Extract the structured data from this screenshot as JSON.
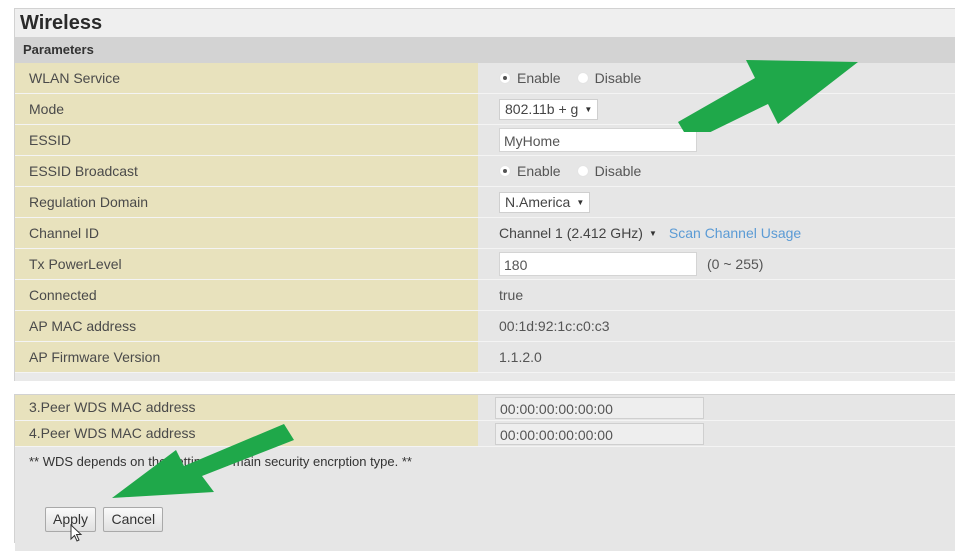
{
  "title": "Wireless",
  "section": "Parameters",
  "rows": {
    "wlan_service": {
      "label": "WLAN Service",
      "enable": "Enable",
      "disable": "Disable",
      "selected": "Enable"
    },
    "mode": {
      "label": "Mode",
      "value": "802.11b + g"
    },
    "essid": {
      "label": "ESSID",
      "value": "MyHome"
    },
    "essid_broadcast": {
      "label": "ESSID Broadcast",
      "enable": "Enable",
      "disable": "Disable",
      "selected": "Enable"
    },
    "regulation_domain": {
      "label": "Regulation Domain",
      "value": "N.America"
    },
    "channel_id": {
      "label": "Channel ID",
      "value": "Channel 1 (2.412 GHz)",
      "link": "Scan Channel Usage"
    },
    "tx_power": {
      "label": "Tx PowerLevel",
      "value": "180",
      "range": "(0 ~ 255)"
    },
    "connected": {
      "label": "Connected",
      "value": "true"
    },
    "ap_mac": {
      "label": "AP MAC address",
      "value": "00:1d:92:1c:c0:c3"
    },
    "ap_firmware": {
      "label": "AP Firmware Version",
      "value": "1.1.2.0"
    }
  },
  "wds": {
    "peer3": {
      "label": "3.Peer WDS MAC address",
      "value": "00:00:00:00:00:00"
    },
    "peer4": {
      "label": "4.Peer WDS MAC address",
      "value": "00:00:00:00:00:00"
    },
    "note": "** WDS depends on the settings of main security encrption type. **"
  },
  "buttons": {
    "apply": "Apply",
    "cancel": "Cancel"
  },
  "colors": {
    "label_bg": "#e8e2bd",
    "value_bg": "#e6e6e6",
    "arrow": "#1fa84a",
    "link": "#5b9bd5"
  }
}
